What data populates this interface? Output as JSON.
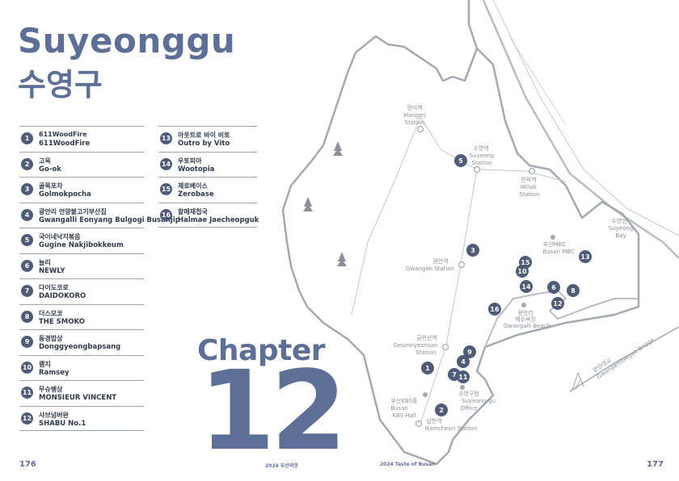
{
  "title_en": "Suyeonggu",
  "title_ko": "수영구",
  "restaurants": [
    {
      "num": "1",
      "ko": "611WoodFire",
      "en": "611WoodFire"
    },
    {
      "num": "2",
      "ko": "고옥",
      "en": "Go-ok"
    },
    {
      "num": "3",
      "ko": "골목포차",
      "en": "Golmokpocha"
    },
    {
      "num": "4",
      "ko": "광안리 언양불고기부산집",
      "en": "Gwangalli Eonyang Bulgogi Busanjip"
    },
    {
      "num": "5",
      "ko": "국이네낙지볶음",
      "en": "Gugine Nakjibokkeum"
    },
    {
      "num": "6",
      "ko": "늘리",
      "en": "NEWLY"
    },
    {
      "num": "7",
      "ko": "다이도코로",
      "en": "DAIDOKORO"
    },
    {
      "num": "8",
      "ko": "더스모코",
      "en": "THE SMOKO"
    },
    {
      "num": "9",
      "ko": "동경밥상",
      "en": "Donggyeongbapsang"
    },
    {
      "num": "10",
      "ko": "램지",
      "en": "Ramsey"
    },
    {
      "num": "11",
      "ko": "무슈뱅상",
      "en": "MONSIEUR VINCENT"
    },
    {
      "num": "12",
      "ko": "샤브넘버완",
      "en": "SHABU No.1"
    },
    {
      "num": "13",
      "ko": "아웃트로 바이 비토",
      "en": "Outro by Vito"
    },
    {
      "num": "14",
      "ko": "우토피아",
      "en": "Wootopia"
    },
    {
      "num": "15",
      "ko": "제로베이스",
      "en": "Zerobase"
    },
    {
      "num": "16",
      "ko": "할매재첩국",
      "en": "Halmae Jaecheopguk"
    }
  ],
  "map_labels": {
    "mangmi": [
      "망미역",
      "Mangmi",
      "Station"
    ],
    "suyeong": [
      "수영역",
      "Suyeong",
      "Station"
    ],
    "millak": [
      "민락역",
      "Millak",
      "Station"
    ],
    "suyeong_bay": [
      "수영만",
      "Suyeong",
      "Bay"
    ],
    "busan_mbc": [
      "부산MBC",
      "Busan MBC"
    ],
    "gwangan": [
      "광안역",
      "Gwangan Station"
    ],
    "gwangalli_beach": [
      "광안리",
      "해수욕장",
      "Gwangalli Beach"
    ],
    "geumnyeonsan": [
      "금련산역",
      "Geumnyeonsan",
      "Station"
    ],
    "kbs": [
      "부산KBS홀",
      "Busan",
      "KBS Hall"
    ],
    "office": [
      "수영구청",
      "Suyeong-gu",
      "Office"
    ],
    "namcheon": [
      "남천역",
      "Namcheon Station"
    ],
    "bridge": [
      "광안대교",
      "Gwangandaegyo Bridge"
    ]
  },
  "chapter_word": "Chapter",
  "chapter_num": "12",
  "page_left": "176",
  "page_right": "177",
  "footer_left": "2024 부산의맛",
  "footer_right": "2024 Taste of Busan",
  "colors": {
    "accent": "#5e6f97",
    "marker": "#4e5c78",
    "map_line": "#b8bcc4"
  }
}
